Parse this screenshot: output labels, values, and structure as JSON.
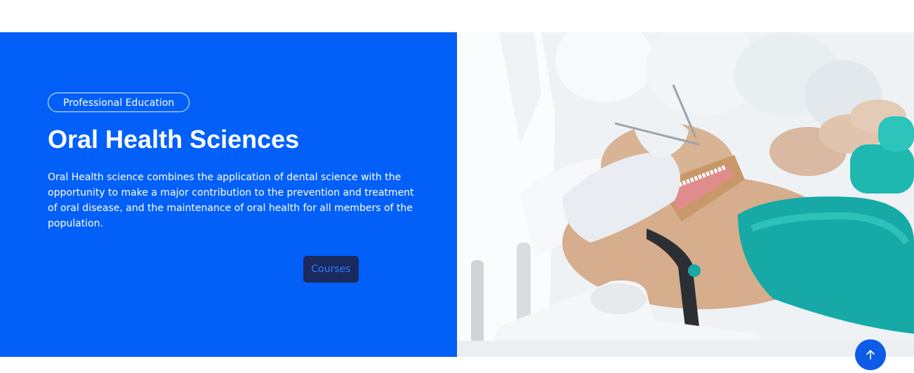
{
  "hero": {
    "badge": "Professional Education",
    "title": "Oral Health Sciences",
    "description": "Oral Health science combines the application of dental science with the opportunity to make a major contribution to the prevention and treatment of oral disease, and the maintenance of oral health for all members of the population.",
    "button_label": "Courses",
    "image_alt": "Dental students practicing on training mannequins"
  },
  "scroll_top": {
    "icon": "arrow-up-icon"
  },
  "colors": {
    "accent_blue": "#0260f8",
    "button_bg": "#1a2a5c",
    "button_text": "#2f7bff",
    "scroll_button": "#0d5be6"
  }
}
